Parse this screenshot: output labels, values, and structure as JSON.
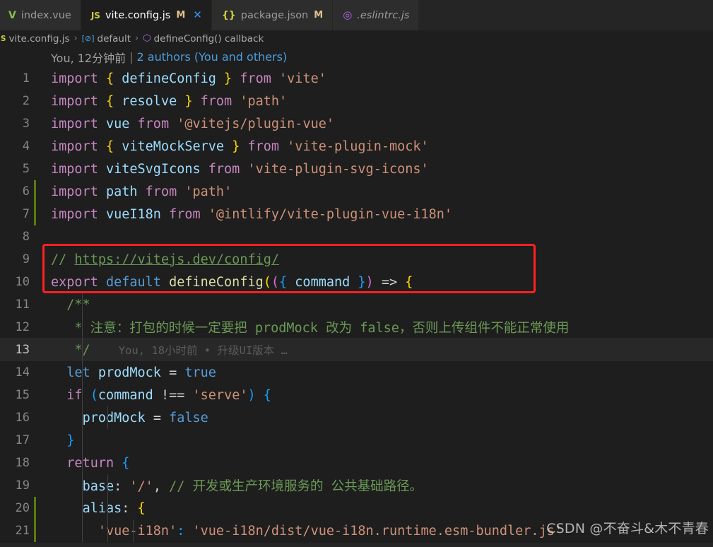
{
  "window": {
    "app": "Visual Studio Code",
    "theme_bg": "#1e1e1e",
    "accent": "#3794ff"
  },
  "tabs": [
    {
      "label": "index.vue",
      "icon": "vue-file-icon",
      "icon_glyph": "V",
      "dirty": "",
      "active": false,
      "preview": false,
      "closable": false
    },
    {
      "label": "vite.config.js",
      "icon": "javascript-file-icon",
      "icon_glyph": "JS",
      "dirty": "M",
      "active": true,
      "preview": false,
      "closable": true,
      "close_glyph": "✕"
    },
    {
      "label": "package.json",
      "icon": "json-file-icon",
      "icon_glyph": "{}",
      "dirty": "M",
      "active": false,
      "preview": false,
      "closable": false
    },
    {
      "label": ".eslintrc.js",
      "icon": "eslint-file-icon",
      "icon_glyph": "◎",
      "dirty": "",
      "active": false,
      "preview": true,
      "closable": false
    }
  ],
  "breadcrumb": {
    "items": [
      {
        "label": "vite.config.js",
        "icon": "javascript-file-icon",
        "icon_glyph": "JS"
      },
      {
        "label": "default",
        "icon": "object-symbol-icon",
        "icon_glyph": "[⊘]"
      },
      {
        "label": "defineConfig() callback",
        "icon": "function-symbol-icon",
        "icon_glyph": "⬡"
      }
    ],
    "separator": "›"
  },
  "blame_header": {
    "author_time": "You, 12分钟前",
    "separator": "|",
    "authors_link": "2 authors (You and others)"
  },
  "inline_blame": {
    "line": 13,
    "text": "You, 18小时前 • 升级UI版本 …"
  },
  "code_lines": [
    {
      "n": 1,
      "gutter": "none",
      "current": false
    },
    {
      "n": 2,
      "gutter": "none",
      "current": false
    },
    {
      "n": 3,
      "gutter": "none",
      "current": false
    },
    {
      "n": 4,
      "gutter": "none",
      "current": false
    },
    {
      "n": 5,
      "gutter": "none",
      "current": false
    },
    {
      "n": 6,
      "gutter": "added",
      "current": false
    },
    {
      "n": 7,
      "gutter": "added",
      "current": false
    },
    {
      "n": 8,
      "gutter": "none",
      "current": false
    },
    {
      "n": 9,
      "gutter": "none",
      "current": false
    },
    {
      "n": 10,
      "gutter": "none",
      "current": false
    },
    {
      "n": 11,
      "gutter": "none",
      "current": false
    },
    {
      "n": 12,
      "gutter": "none",
      "current": false
    },
    {
      "n": 13,
      "gutter": "none",
      "current": true
    },
    {
      "n": 14,
      "gutter": "none",
      "current": false
    },
    {
      "n": 15,
      "gutter": "none",
      "current": false
    },
    {
      "n": 16,
      "gutter": "none",
      "current": false
    },
    {
      "n": 17,
      "gutter": "none",
      "current": false
    },
    {
      "n": 18,
      "gutter": "none",
      "current": false
    },
    {
      "n": 19,
      "gutter": "none",
      "current": false
    },
    {
      "n": 20,
      "gutter": "added",
      "current": false
    },
    {
      "n": 21,
      "gutter": "added",
      "current": false
    }
  ],
  "code_text": {
    "l1": "import { defineConfig } from 'vite'",
    "l2": "import { resolve } from 'path'",
    "l3": "import vue from '@vitejs/plugin-vue'",
    "l4": "import { viteMockServe } from 'vite-plugin-mock'",
    "l5": "import viteSvgIcons from 'vite-plugin-svg-icons'",
    "l6": "import path from 'path'",
    "l7": "import vueI18n from '@intlify/vite-plugin-vue-i18n'",
    "l8": "",
    "l9": "// https://vitejs.dev/config/",
    "l10": "export default defineConfig(({ command }) => {",
    "l11": "  /**",
    "l12": "   * 注意：打包的时候一定要把 prodMock 改为 false，否则上传组件不能正常使用",
    "l13": "   */",
    "l14": "  let prodMock = true",
    "l15": "  if (command !== 'serve') {",
    "l16": "    prodMock = false",
    "l17": "  }",
    "l18": "  return {",
    "l19": "    base: '/', // 开发或生产环境服务的 公共基础路径。",
    "l20": "    alias: {",
    "l21": "      'vue-i18n': 'vue-i18n/dist/vue-i18n.runtime.esm-bundler.js'"
  },
  "tokens": {
    "kw_import": "import",
    "kw_from": "from",
    "kw_export": "export",
    "kw_default": "default",
    "kw_let": "let",
    "kw_if": "if",
    "kw_return": "return",
    "id_defineConfig": "defineConfig",
    "id_resolve": "resolve",
    "id_vue": "vue",
    "id_viteMockServe": "viteMockServe",
    "id_viteSvgIcons": "viteSvgIcons",
    "id_path": "path",
    "id_vueI18n": "vueI18n",
    "id_command": "command",
    "id_prodMock": "prodMock",
    "id_true": "true",
    "id_false": "false",
    "id_base": "base",
    "id_alias": "alias",
    "str_vite": "'vite'",
    "str_path": "'path'",
    "str_pluginvue": "'@vitejs/plugin-vue'",
    "str_pluginmock": "'vite-plugin-mock'",
    "str_svgicons": "'vite-plugin-svg-icons'",
    "str_i18nplugin": "'@intlify/vite-plugin-vue-i18n'",
    "str_serve": "'serve'",
    "str_slash": "'/'",
    "str_vuei18nkey": "'vue-i18n'",
    "str_vuei18nval": "'vue-i18n/dist/vue-i18n.runtime.esm-bundler.js'",
    "cmt_url_prefix": "// ",
    "cmt_url": "https://vitejs.dev/config/",
    "cmt_jsdoc_open": "/**",
    "cmt_jsdoc_star": "* ",
    "cmt_jsdoc_body": "注意：打包的时候一定要把 prodMock 改为 false，否则上传组件不能正常使用",
    "cmt_jsdoc_close": "*/",
    "cmt_base": "// 开发或生产环境服务的 公共基础路径。"
  },
  "annotation": {
    "type": "red-rectangle-highlight",
    "color": "#ff2020",
    "covers_lines": "6-7"
  },
  "watermark": {
    "text": "CSDN @不奋斗&木不青春"
  }
}
